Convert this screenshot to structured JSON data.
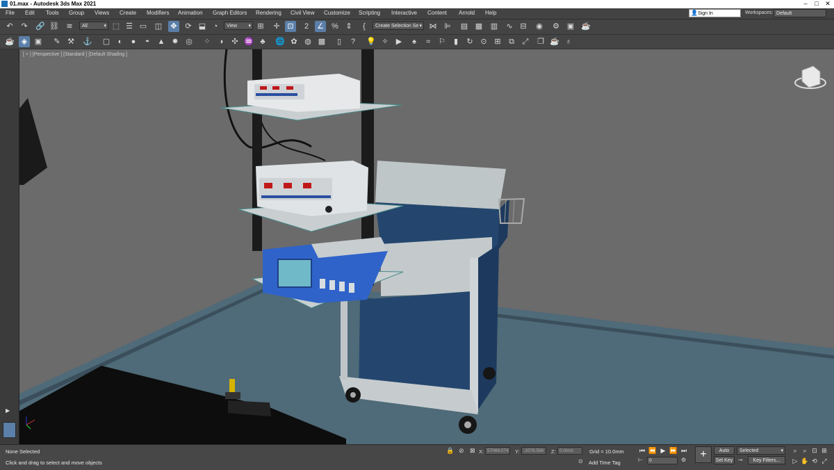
{
  "window": {
    "title": "01.max - Autodesk 3ds Max 2021",
    "min": "–",
    "max": "□",
    "close": "✕"
  },
  "menu": [
    "File",
    "Edit",
    "Tools",
    "Group",
    "Views",
    "Create",
    "Modifiers",
    "Animation",
    "Graph Editors",
    "Rendering",
    "Civil View",
    "Customize",
    "Scripting",
    "Interactive",
    "Content",
    "Arnold",
    "Help"
  ],
  "account": {
    "signin": "Sign In",
    "workspaces_label": "Workspaces:",
    "workspace": "Default"
  },
  "toolbar": {
    "filter": "All",
    "ref_coord": "View",
    "selection_set": "Create Selection Se"
  },
  "viewport": {
    "label": "[ + ] [Perspective ] [Standard ] [Default Shading ]",
    "viewcube": "top"
  },
  "status": {
    "selection": "None Selected",
    "prompt": "Click and drag to select and move objects",
    "x_label": "X:",
    "x": "57066.074",
    "y_label": "Y:",
    "y": "-2076.586",
    "z_label": "Z:",
    "z": "0.0mm",
    "grid": "Grid = 10.0mm",
    "add_time_tag": "Add Time Tag",
    "frame": "0",
    "auto_key": "Auto Key",
    "set_key": "Set Key",
    "key_mode": "Selected",
    "key_filters": "Key Filters..."
  },
  "colors": {
    "viewport_bg": "#6b6b6b",
    "floor": "#4f6a78",
    "cabinet_blue": "#24466e",
    "device_blue": "#2f63c9"
  }
}
